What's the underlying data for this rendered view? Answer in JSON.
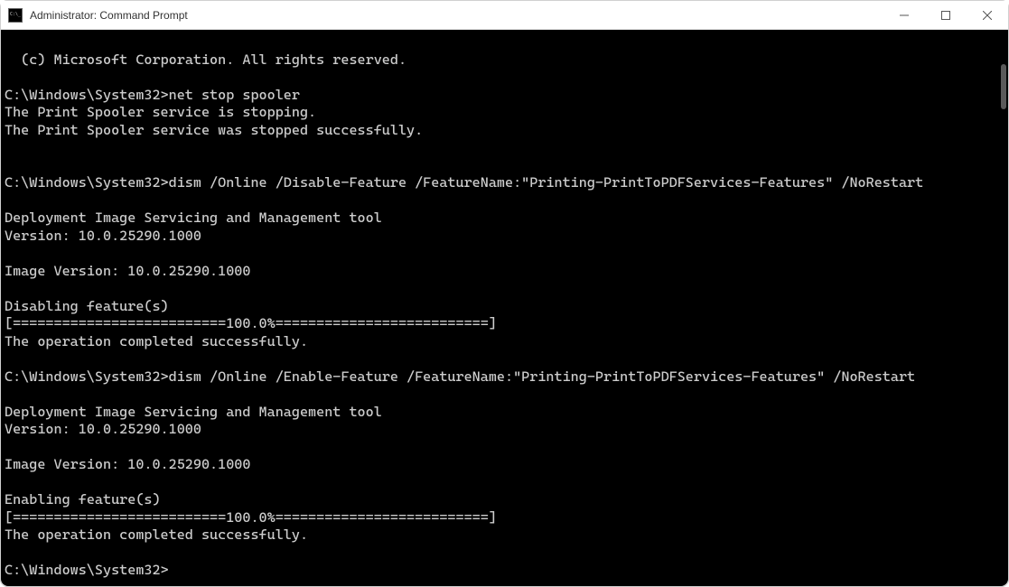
{
  "window": {
    "title": "Administrator: Command Prompt"
  },
  "terminal": {
    "lines": [
      "(c) Microsoft Corporation. All rights reserved.",
      "",
      "C:\\Windows\\System32>net stop spooler",
      "The Print Spooler service is stopping.",
      "The Print Spooler service was stopped successfully.",
      "",
      "",
      "C:\\Windows\\System32>dism /Online /Disable-Feature /FeatureName:\"Printing-PrintToPDFServices-Features\" /NoRestart",
      "",
      "Deployment Image Servicing and Management tool",
      "Version: 10.0.25290.1000",
      "",
      "Image Version: 10.0.25290.1000",
      "",
      "Disabling feature(s)",
      "[==========================100.0%==========================]",
      "The operation completed successfully.",
      "",
      "C:\\Windows\\System32>dism /Online /Enable-Feature /FeatureName:\"Printing-PrintToPDFServices-Features\" /NoRestart",
      "",
      "Deployment Image Servicing and Management tool",
      "Version: 10.0.25290.1000",
      "",
      "Image Version: 10.0.25290.1000",
      "",
      "Enabling feature(s)",
      "[==========================100.0%==========================]",
      "The operation completed successfully.",
      "",
      "C:\\Windows\\System32>"
    ]
  }
}
